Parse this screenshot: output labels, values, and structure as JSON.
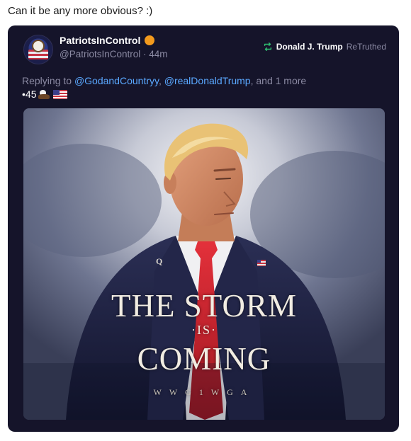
{
  "caption": "Can it be any more obvious? :)",
  "post": {
    "author_name": "PatriotsInControl",
    "author_handle": "@PatriotsInControl",
    "time": "44m",
    "retruth": {
      "name": "Donald J. Trump",
      "label": "ReTruthed"
    },
    "reply": {
      "prefix": "Replying to",
      "mention1": "@GodandCountryy",
      "sep": ",",
      "mention2": "@realDonaldTrump",
      "suffix": ", and 1 more"
    },
    "body_text": "•45"
  },
  "image_text": {
    "line1": "THE STORM",
    "line2": "·IS·",
    "line3": "COMING",
    "line4": "WWG1WGA",
    "lapel": "Q"
  },
  "colors": {
    "card_bg": "#15142a",
    "mention": "#5aa8ff",
    "verified_badge": "#f39a1d",
    "retruth_icon": "#2fbf71"
  }
}
